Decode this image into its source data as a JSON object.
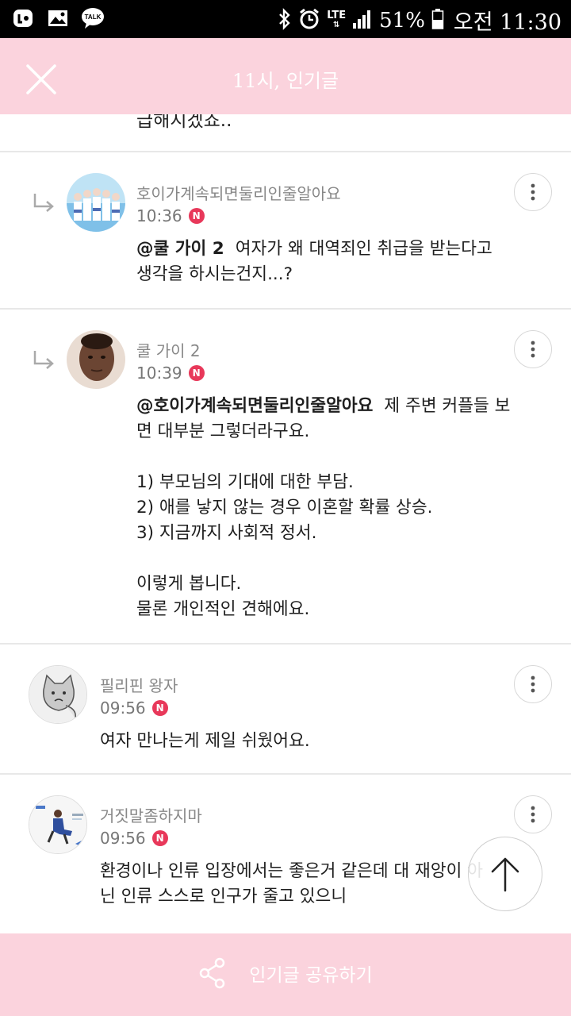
{
  "status_bar": {
    "network": "LTE",
    "battery": "51%",
    "time": "오전 11:30",
    "icons": [
      "kakao-icon",
      "gallery-icon",
      "talk-icon",
      "bluetooth-icon",
      "alarm-icon",
      "signal-icon",
      "battery-icon"
    ],
    "talk_label": "TALK"
  },
  "header": {
    "title": "11시, 인기글",
    "close_icon": "close-icon",
    "background": "#fbd3dd"
  },
  "feed": {
    "cut_text": "급해지겠죠..",
    "comments": [
      {
        "is_reply": true,
        "username": "호이가계속되면둘리인줄알아요",
        "time": "10:36",
        "badge": "N",
        "mention": "@쿨 가이 2",
        "text": "여자가 왜 대역죄인 취급을 받는다고\n생각을 하시는건지...?"
      },
      {
        "is_reply": true,
        "username": "쿨 가이 2",
        "time": "10:39",
        "badge": "N",
        "mention": "@호이가계속되면둘리인줄알아요",
        "text": "제 주변 커플들 보\n면 대부분 그렇더라구요.\n\n1) 부모님의 기대에 대한 부담.\n2) 애를 낳지 않는 경우 이혼할 확률 상승.\n3) 지금까지 사회적 정서.\n\n이렇게 봅니다.\n물론 개인적인 견해에요."
      },
      {
        "is_reply": false,
        "username": "필리핀 왕자",
        "time": "09:56",
        "badge": "N",
        "text": "여자 만나는게 제일 쉬웠어요."
      },
      {
        "is_reply": false,
        "username": "거짓말좀하지마",
        "time": "09:56",
        "badge": "N",
        "text": "환경이나 인류 입장에서는 좋은거 같은데 대 재앙이 아\n닌 인류 스스로 인구가 줄고 있으니"
      }
    ]
  },
  "scroll_top_icon": "arrow-up-icon",
  "bottom_bar": {
    "share_label": "인기글 공유하기",
    "share_icon": "share-icon"
  },
  "colors": {
    "accent_pink": "#fbd3dd",
    "new_badge": "#e8385a"
  }
}
